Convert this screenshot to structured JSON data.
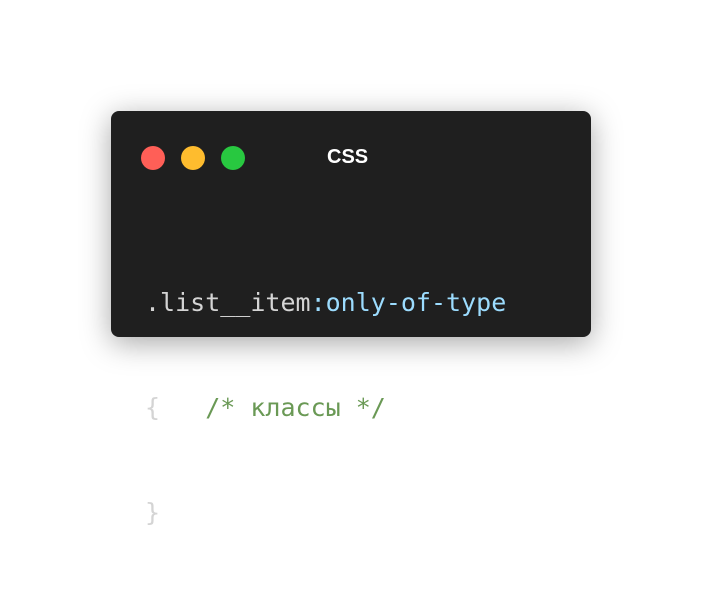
{
  "window": {
    "title": "CSS",
    "controls": {
      "close_color": "#ff5f57",
      "minimize_color": "#febc2e",
      "maximize_color": "#28c840"
    }
  },
  "code": {
    "line1": {
      "selector": ".list__item",
      "pseudo": ":only-of-type"
    },
    "line2": {
      "brace_open": "{",
      "spacing": "   ",
      "comment": "/* классы */"
    },
    "line3": {
      "brace_close": "}"
    }
  },
  "colors": {
    "background": "#1f1f1f",
    "text": "#d4d4d4",
    "pseudo": "#9cdcfe",
    "comment": "#6a9955"
  }
}
